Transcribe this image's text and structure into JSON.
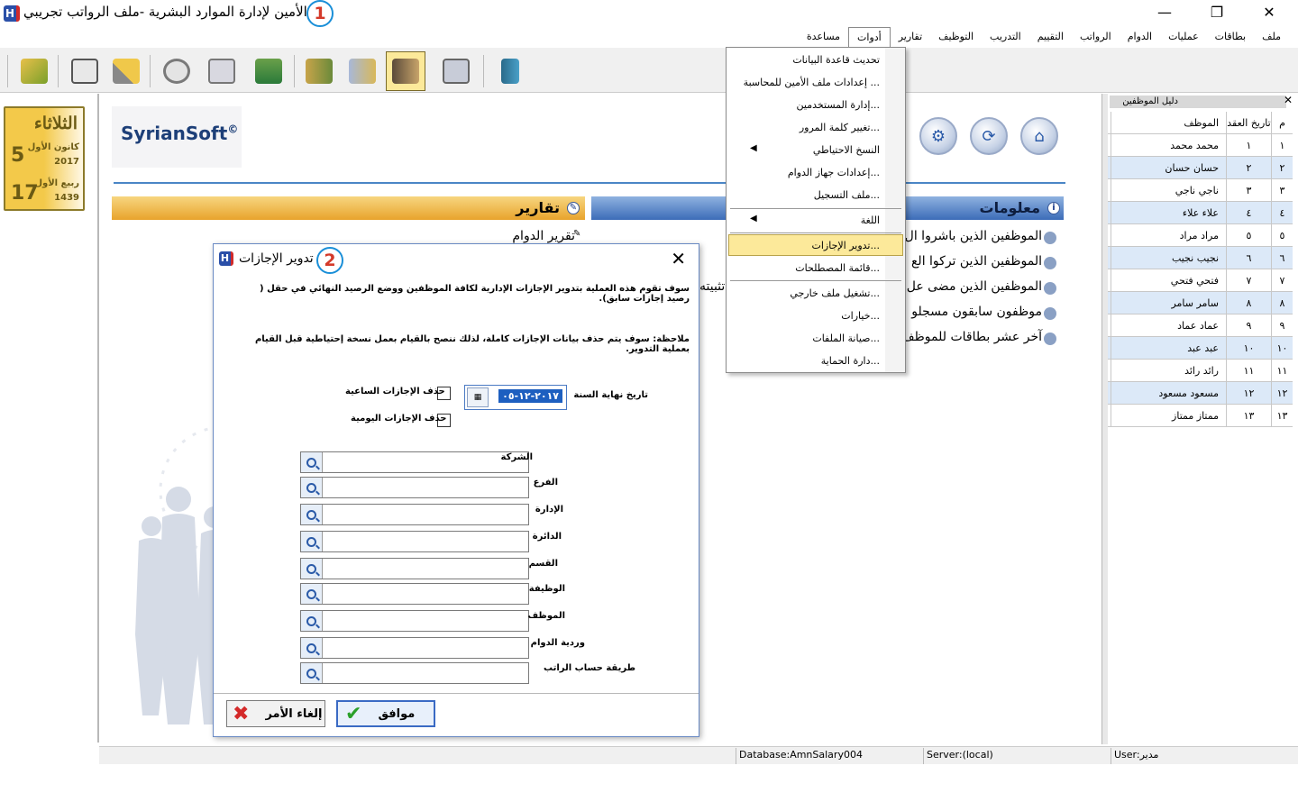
{
  "window": {
    "title": "الأمين لإدارة الموارد البشرية -ملف الرواتب تجريبي",
    "app_icon": "app-logo-icon",
    "controls": {
      "minimize": "—",
      "restore": "❐",
      "close": "✕"
    }
  },
  "annotations": {
    "badge1": "1",
    "badge2": "2"
  },
  "menubar": {
    "items": [
      "ملف",
      "بطاقات",
      "عمليات",
      "الدوام",
      "الرواتب",
      "التقييم",
      "التدريب",
      "التوظيف",
      "تقارير",
      "أدوات",
      "مساعدة"
    ],
    "active": "أدوات"
  },
  "toolbar": {
    "icons": [
      "folder-refresh-icon",
      "employee-card-icon",
      "wand-icon",
      "clock-icon",
      "schedule-icon",
      "money-icon",
      "books-icon",
      "documents-icon",
      "people-icon",
      "calculator-icon",
      "exit-door-icon"
    ],
    "selected": "people-icon"
  },
  "calendar": {
    "day_name": "الثلاثاء",
    "day": "5",
    "month": "كانون الأول",
    "year": "2017",
    "hijri_day": "17",
    "hijri_month": "ربيع الأول",
    "hijri_year": "1439"
  },
  "main": {
    "brand": "SyrianSoft",
    "brand_mark": "©",
    "nav_icons": [
      "home-icon",
      "refresh-icon",
      "settings-icon"
    ],
    "reports_header": "تقارير",
    "info_header": "معلومات",
    "report_links": [
      "تقرير الدوام"
    ],
    "info_links": [
      "الموظفين الذين باشروا ال",
      "الموظفين الذين تركوا الع",
      "الموظفين الذين مضى عل",
      "موظفون سابقون مسجلو",
      "آخر عشر بطاقات للموظف"
    ],
    "partial_text": "تثبيته"
  },
  "dropdown": {
    "items": [
      "تحديث قاعدة البيانات",
      "إعدادات ملف الأمين للمحاسبة ...",
      "إدارة المستخدمين...",
      "تغيير كلمة المرور...",
      "النسخ الاحتياطي",
      "إعدادات جهاز الدوام...",
      "ملف التسجيل...",
      "اللغة",
      "تدوير الإجازات...",
      "قائمة المصطلحات...",
      "تشغيل ملف خارجي...",
      "خيارات...",
      "صيانة الملفات...",
      "دارة الحماية..."
    ],
    "highlighted": "تدوير الإجازات..."
  },
  "dialog": {
    "title": "تدوير الإجازات",
    "close": "✕",
    "description": "سوف تقوم هذه العملية بتدوير الإجازات الإدارية لكافة الموظفين ووضع الرصيد  النهائي في حقل ( رصيد إجازات سابق).",
    "note": "ملاحظة: سوف يتم حذف بيانات الإجازات كاملة، لذلك ننصح بالقيام بعمل نسخة إحتياطية قبل القيام بعملية التدوير.",
    "date_label": "تاريخ نهاية السنة",
    "date_value": "٢٠١٧-١٢-٠٥",
    "checkbox_hourly": "حذف الإجازات الساعية",
    "checkbox_daily": "حذف الإجازات اليومية",
    "filters": [
      "الشركة",
      "الفرع",
      "الإدارة",
      "الدائرة",
      "القسم",
      "الوظيفة",
      "الموظف",
      "وردية الدوام",
      "طريقة حساب الراتب"
    ],
    "ok_label": "موافق",
    "cancel_label": "إلغاء الأمر"
  },
  "employee_panel": {
    "title": "دليل الموظفين",
    "close": "✕",
    "columns": [
      "م",
      "تاريخ العقد",
      "الموظف"
    ],
    "rows": [
      [
        "١",
        "١",
        "محمد محمد"
      ],
      [
        "٢",
        "٢",
        "حسان حسان"
      ],
      [
        "٣",
        "٣",
        "ناجي ناجي"
      ],
      [
        "٤",
        "٤",
        "علاء علاء"
      ],
      [
        "٥",
        "٥",
        "مراد مراد"
      ],
      [
        "٦",
        "٦",
        "نجيب نجيب"
      ],
      [
        "٧",
        "٧",
        "فتحي فتحي"
      ],
      [
        "٨",
        "٨",
        "سامر سامر"
      ],
      [
        "٩",
        "٩",
        "عماد عماد"
      ],
      [
        "١٠",
        "١٠",
        "عبد عبد"
      ],
      [
        "١١",
        "١١",
        "رائد رائد"
      ],
      [
        "١٢",
        "١٢",
        "مسعود مسعود"
      ],
      [
        "١٣",
        "١٣",
        "ممتاز ممتاز"
      ]
    ]
  },
  "statusbar": {
    "database": "Database:AmnSalary004",
    "server": "Server:(local)",
    "user": "User:مدير"
  },
  "colors": {
    "accent_blue": "#1a8fd8",
    "highlight_yellow": "#fce99a",
    "brand_blue": "#1d3f78",
    "row_alt": "#dce9f8"
  }
}
